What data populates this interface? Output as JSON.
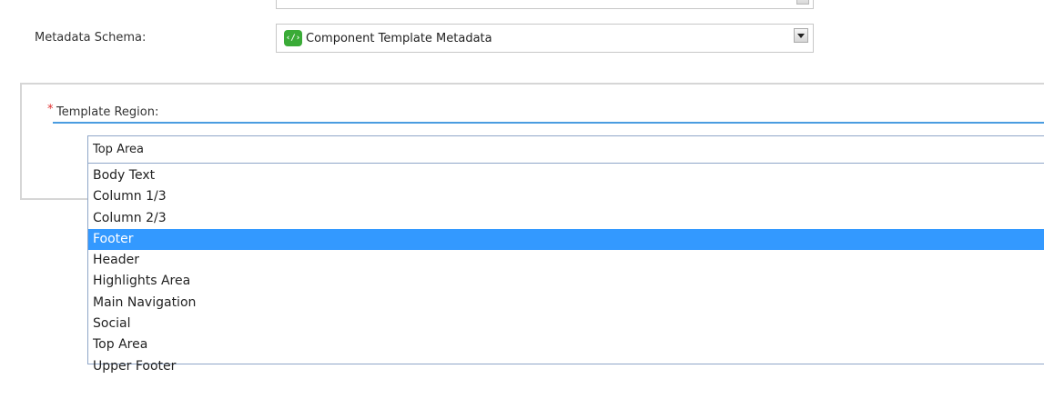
{
  "metadata_schema": {
    "label": "Metadata Schema:",
    "selected_value": "Component Template Metadata",
    "icon": "schema-icon",
    "icon_glyph": "‹/›",
    "icon_color": "#3aab37"
  },
  "template_region": {
    "required_marker": "*",
    "label": "Template Region:",
    "current_value": "Top Area",
    "options": [
      "Body Text",
      "Column 1/3",
      "Column 2/3",
      "Footer",
      "Header",
      "Highlights Area",
      "Main Navigation",
      "Social",
      "Top Area",
      "Upper Footer"
    ],
    "highlighted_option": "Footer",
    "highlight_color": "#3399ff"
  }
}
